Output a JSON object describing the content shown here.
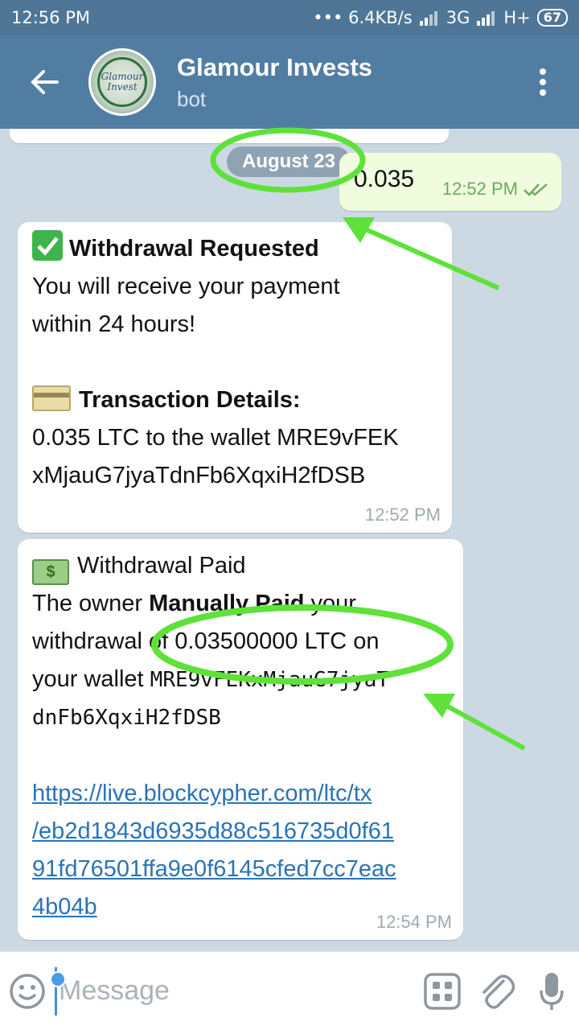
{
  "status_bar": {
    "time": "12:56 PM",
    "network_speed": "••• 6.4KB/s",
    "network_type_1": "3G",
    "network_type_2": "H+",
    "battery": "67"
  },
  "header": {
    "title": "Glamour Invests",
    "subtitle": "bot",
    "avatar_text": "Glamour Invest"
  },
  "chat": {
    "date_label": "August 23",
    "outgoing": {
      "text": "0.035",
      "time": "12:52 PM"
    },
    "msg1": {
      "heading": "Withdrawal Requested",
      "line1": "You will receive your payment",
      "line2": "within 24 hours!",
      "details_heading": "Transaction Details:",
      "details_line1": "0.035 LTC to the wallet MRE9vFEK",
      "details_line2": "xMjauG7jyaTdnFb6XqxiH2fDSB",
      "time": "12:52 PM"
    },
    "msg2": {
      "heading": "Withdrawal Paid",
      "line1_a": "The owner ",
      "line1_b": "Manually Paid",
      "line1_c": " your",
      "line2": "withdrawal of 0.03500000 LTC on",
      "line3_a": "your wallet ",
      "line3_b": "MRE9vFEKxMjauG7jyaT",
      "line4": "dnFb6XqxiH2fDSB",
      "link_line1": "https://live.blockcypher.com/ltc/tx",
      "link_line2": "/eb2d1843d6935d88c516735d0f61",
      "link_line3": "91fd76501ffa9e0f6145cfed7cc7eac",
      "link_line4": "4b04b",
      "time": "12:54 PM"
    }
  },
  "input": {
    "placeholder": "Message"
  },
  "colors": {
    "header": "#527da3",
    "status_bar": "#4f7697",
    "annotation": "#5ee23a",
    "link": "#2a73b6"
  },
  "icons": [
    "back-arrow-icon",
    "more-vert-icon",
    "emoji-icon",
    "bot-keyboard-icon",
    "attach-icon",
    "mic-icon",
    "double-check-icon"
  ]
}
